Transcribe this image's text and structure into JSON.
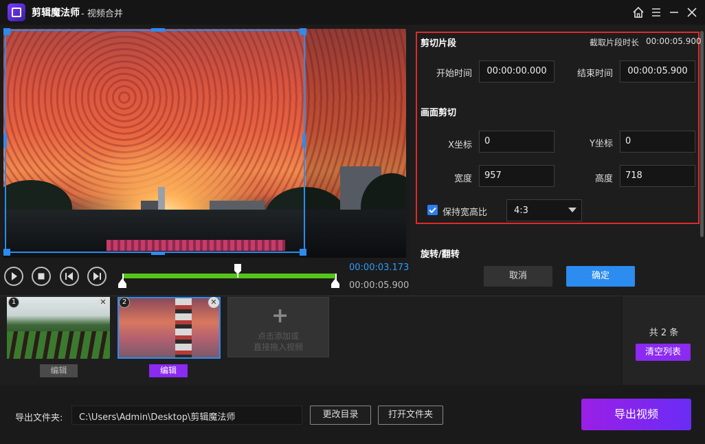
{
  "titlebar": {
    "app_name": "剪辑魔法师",
    "subtitle": "- 视频合并",
    "icons": [
      "home-icon",
      "menu-icon",
      "minimize-icon",
      "close-icon"
    ]
  },
  "player": {
    "time_current": "00:00:03.173",
    "time_total": "00:00:05.900",
    "progress_fraction": 0.538,
    "controls": [
      "play-icon",
      "stop-icon",
      "prev-frame-icon",
      "next-frame-icon"
    ]
  },
  "panel": {
    "cut_section_title": "剪切片段",
    "clip_duration_label": "截取片段时长",
    "clip_duration_value": "00:00:05.900",
    "start_time_label": "开始时间",
    "start_time_value": "00:00:00.000",
    "end_time_label": "结束时间",
    "end_time_value": "00:00:05.900",
    "crop_section_title": "画面剪切",
    "x_label": "X坐标",
    "x_value": "0",
    "y_label": "Y坐标",
    "y_value": "0",
    "width_label": "宽度",
    "width_value": "957",
    "height_label": "高度",
    "height_value": "718",
    "keep_ratio_label": "保持宽高比",
    "keep_ratio_checked": true,
    "ratio_value": "4:3",
    "rotate_section_title": "旋转/翻转",
    "cancel_label": "取消",
    "ok_label": "确定"
  },
  "clips": [
    {
      "number": "1",
      "edit_label": "编辑",
      "selected": false
    },
    {
      "number": "2",
      "edit_label": "编辑",
      "selected": true
    }
  ],
  "add_tile": {
    "line1": "点击添加或",
    "line2": "直接拖入视频"
  },
  "clip_summary": {
    "count_text": "共 2 条",
    "clear_label": "清空列表"
  },
  "export": {
    "folder_label": "导出文件夹:",
    "folder_path": "C:\\Users\\Admin\\Desktop\\剪辑魔法师",
    "change_dir_label": "更改目录",
    "open_folder_label": "打开文件夹",
    "export_label": "导出视频"
  },
  "colors": {
    "accent_blue": "#2c8cf0",
    "accent_purple": "#8b2af0",
    "highlight_red": "#e02a2a",
    "track_green": "#56c41a"
  }
}
